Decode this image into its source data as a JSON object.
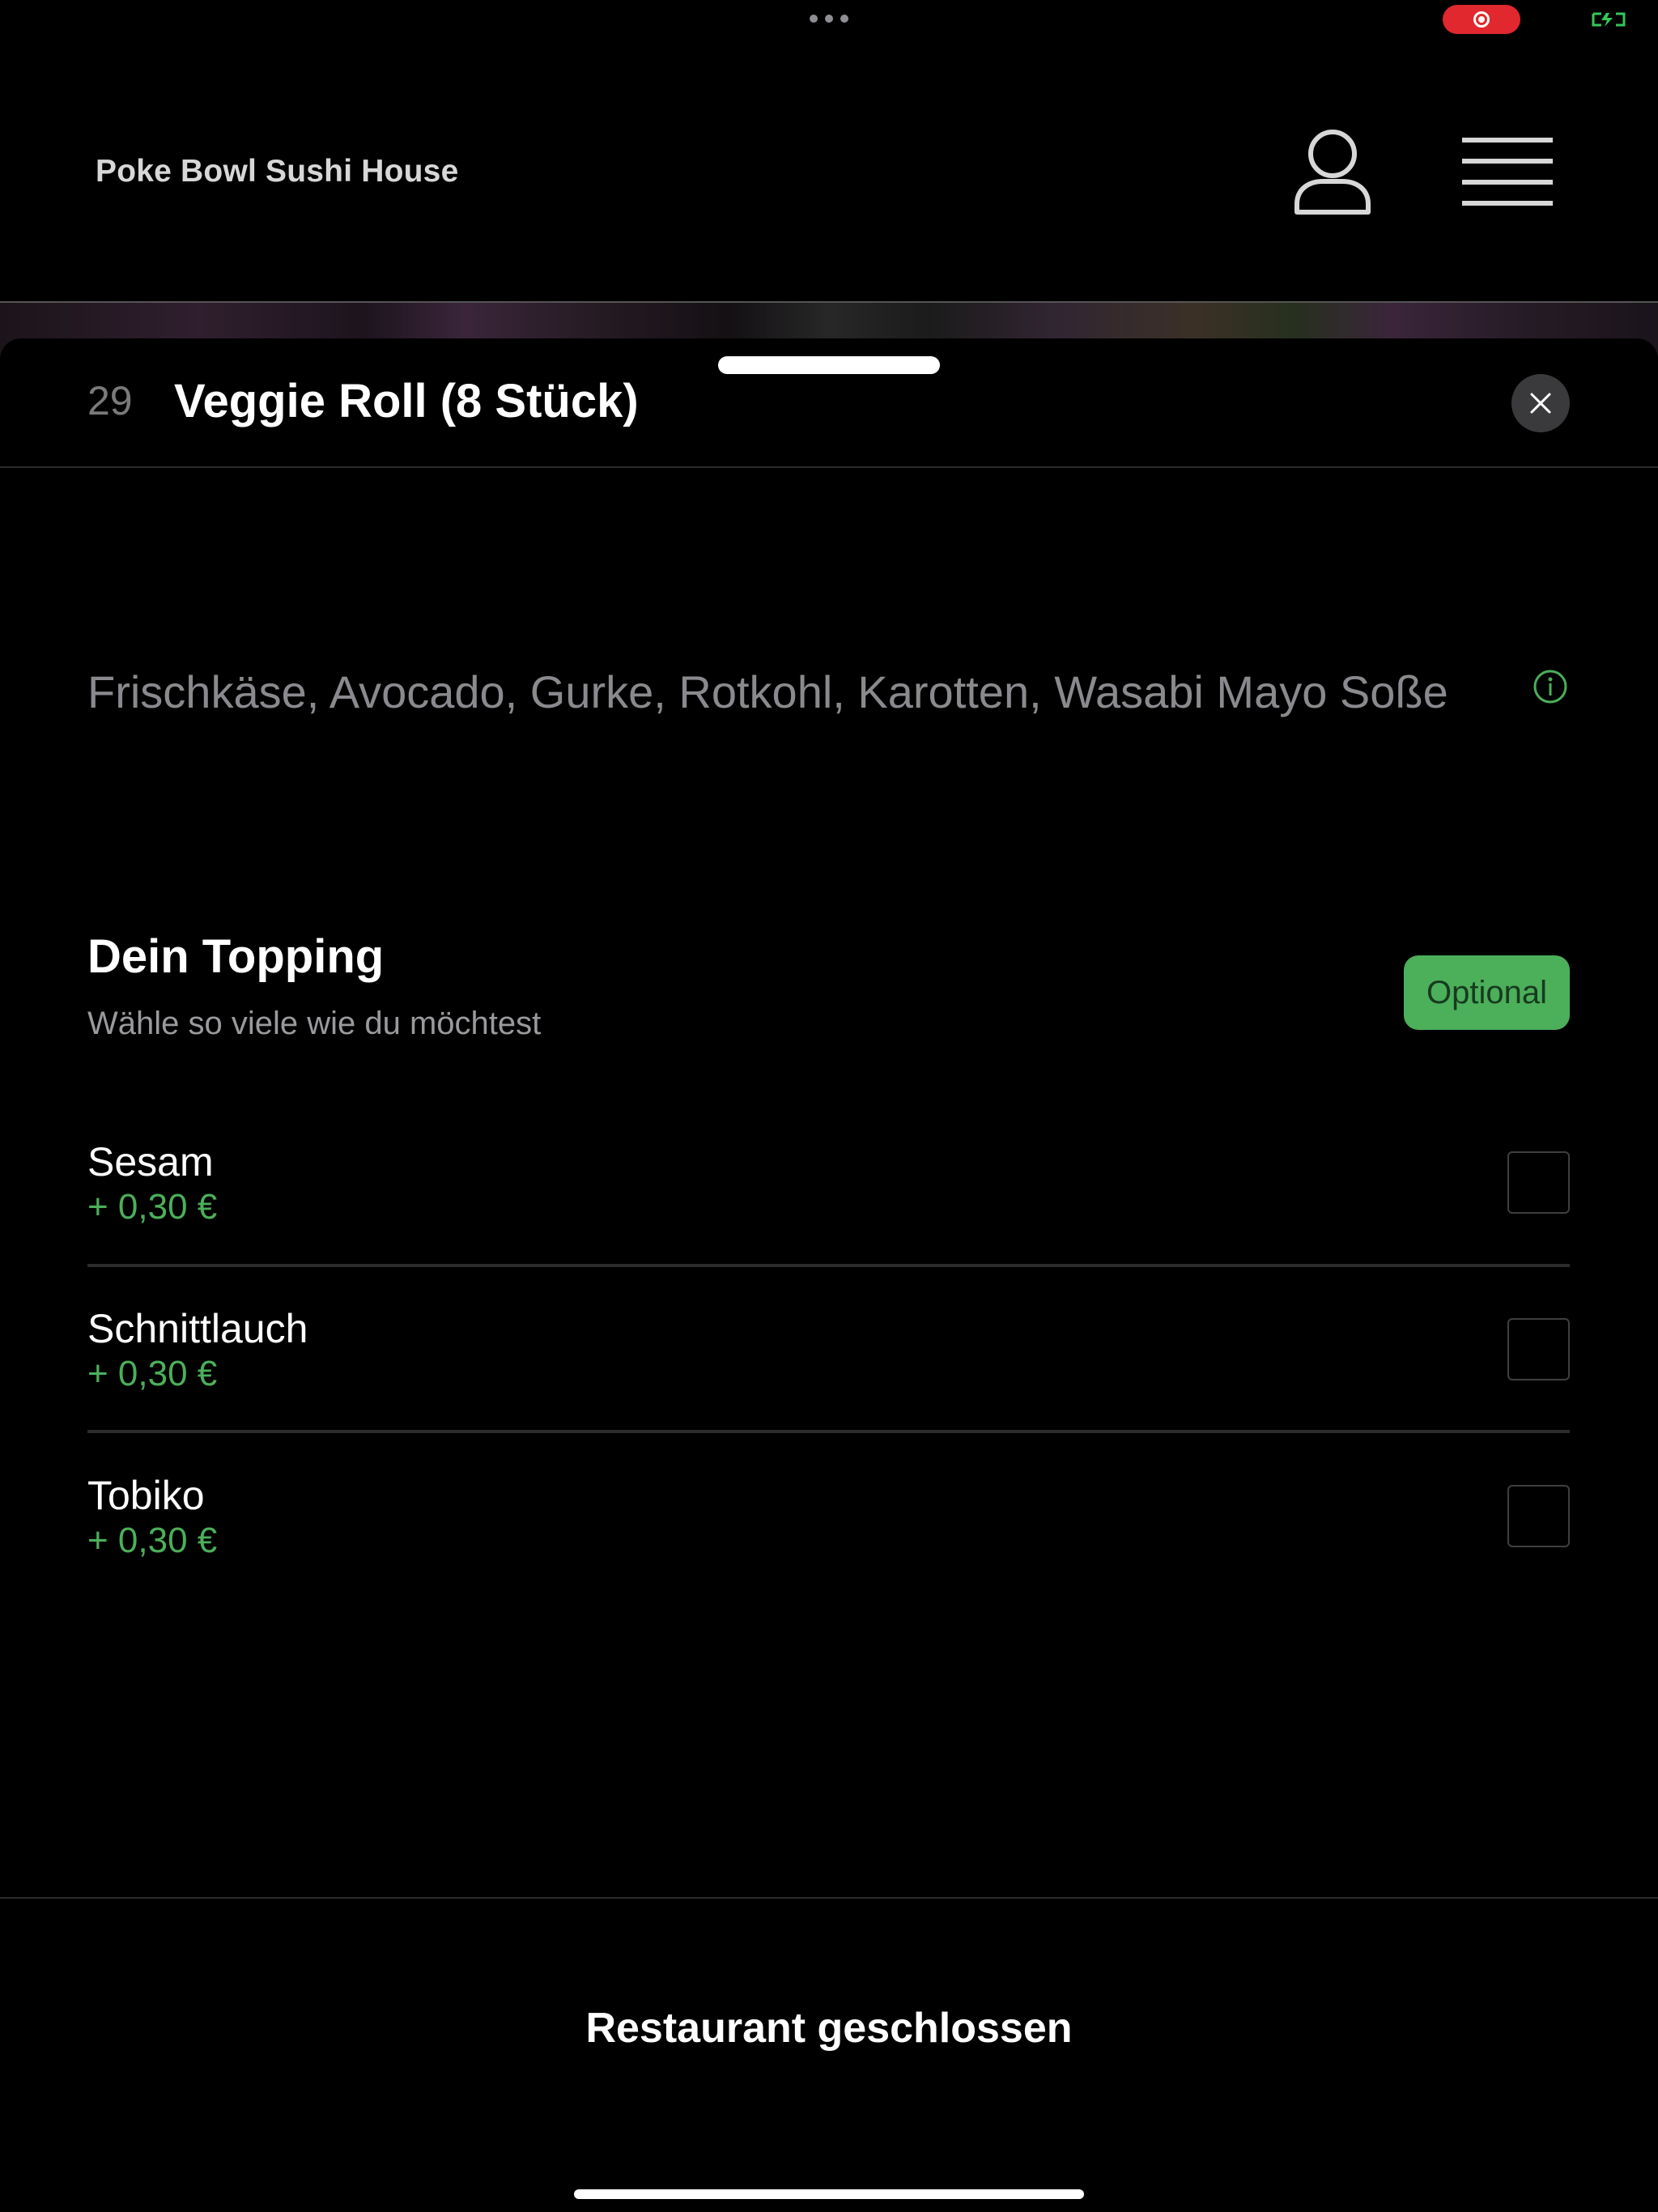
{
  "status_bar": {
    "icons": [
      "more-dots-icon",
      "screen-recording-icon",
      "battery-charging-icon"
    ],
    "recording_color": "#e0282e",
    "battery_color": "#34c759"
  },
  "header": {
    "brand": "Poke Bowl Sushi House",
    "icons": [
      "user-icon",
      "hamburger-menu-icon"
    ]
  },
  "item": {
    "number": "29",
    "title": "Veggie Roll (8 Stück)",
    "description": "Frischkäse, Avocado, Gurke, Rotkohl, Karotten, Wasabi Mayo Soße"
  },
  "topping_group": {
    "title": "Dein Topping",
    "subtitle": "Wähle so viele wie du möchtest",
    "badge": "Optional",
    "options": [
      {
        "name": "Sesam",
        "price": "+ 0,30 €",
        "checked": false
      },
      {
        "name": "Schnittlauch",
        "price": "+ 0,30 €",
        "checked": false
      },
      {
        "name": "Tobiko",
        "price": "+ 0,30 €",
        "checked": false
      }
    ]
  },
  "footer": {
    "status": "Restaurant geschlossen"
  },
  "colors": {
    "accent": "#4caf5a",
    "background": "#000000",
    "muted_text": "#8a8a8e"
  }
}
